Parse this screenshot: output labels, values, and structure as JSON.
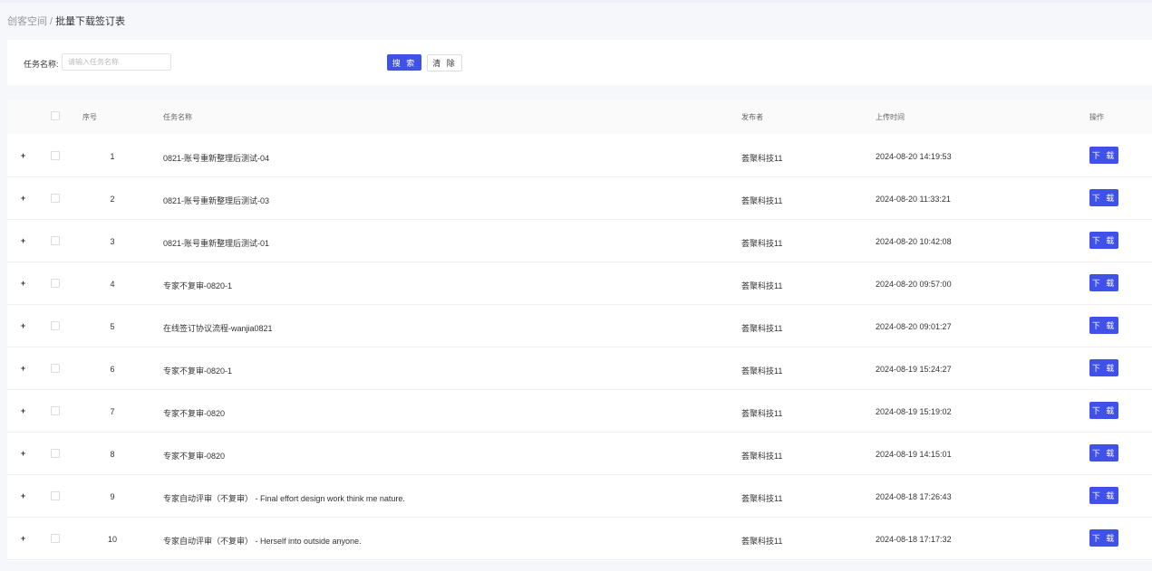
{
  "breadcrumb": {
    "parent": "创客空间",
    "separator": "/",
    "current": "批量下载签订表"
  },
  "search": {
    "label": "任务名称:",
    "placeholder": "请输入任务名称",
    "value": "",
    "search_button": "搜 索",
    "clear_button": "清 除"
  },
  "table": {
    "columns": {
      "index": "序号",
      "task_name": "任务名称",
      "publisher": "发布者",
      "upload_time": "上传时间",
      "action": "操作"
    },
    "rows": [
      {
        "index": "1",
        "task_name": "0821-账号重新整理后测试-04",
        "publisher": "荟聚科技11",
        "upload_time": "2024-08-20 14:19:53",
        "action": "下 载"
      },
      {
        "index": "2",
        "task_name": "0821-账号重新整理后测试-03",
        "publisher": "荟聚科技11",
        "upload_time": "2024-08-20 11:33:21",
        "action": "下 载"
      },
      {
        "index": "3",
        "task_name": "0821-账号重新整理后测试-01",
        "publisher": "荟聚科技11",
        "upload_time": "2024-08-20 10:42:08",
        "action": "下 载"
      },
      {
        "index": "4",
        "task_name": "专家不复审-0820-1",
        "publisher": "荟聚科技11",
        "upload_time": "2024-08-20 09:57:00",
        "action": "下 载"
      },
      {
        "index": "5",
        "task_name": "在线签订协议流程-wanjia0821",
        "publisher": "荟聚科技11",
        "upload_time": "2024-08-20 09:01:27",
        "action": "下 载"
      },
      {
        "index": "6",
        "task_name": "专家不复审-0820-1",
        "publisher": "荟聚科技11",
        "upload_time": "2024-08-19 15:24:27",
        "action": "下 载"
      },
      {
        "index": "7",
        "task_name": "专家不复审-0820",
        "publisher": "荟聚科技11",
        "upload_time": "2024-08-19 15:19:02",
        "action": "下 载"
      },
      {
        "index": "8",
        "task_name": "专家不复审-0820",
        "publisher": "荟聚科技11",
        "upload_time": "2024-08-19 14:15:01",
        "action": "下 载"
      },
      {
        "index": "9",
        "task_name": "专家自动评审（不复审） - Final effort design work think me nature.",
        "publisher": "荟聚科技11",
        "upload_time": "2024-08-18 17:26:43",
        "action": "下 载"
      },
      {
        "index": "10",
        "task_name": "专家自动评审（不复审） - Herself into outside anyone.",
        "publisher": "荟聚科技11",
        "upload_time": "2024-08-18 17:17:32",
        "action": "下 载"
      }
    ]
  },
  "colors": {
    "primary": "#3f51e8",
    "page_background": "#f5f7fb"
  },
  "icons": {
    "expand": "+"
  }
}
